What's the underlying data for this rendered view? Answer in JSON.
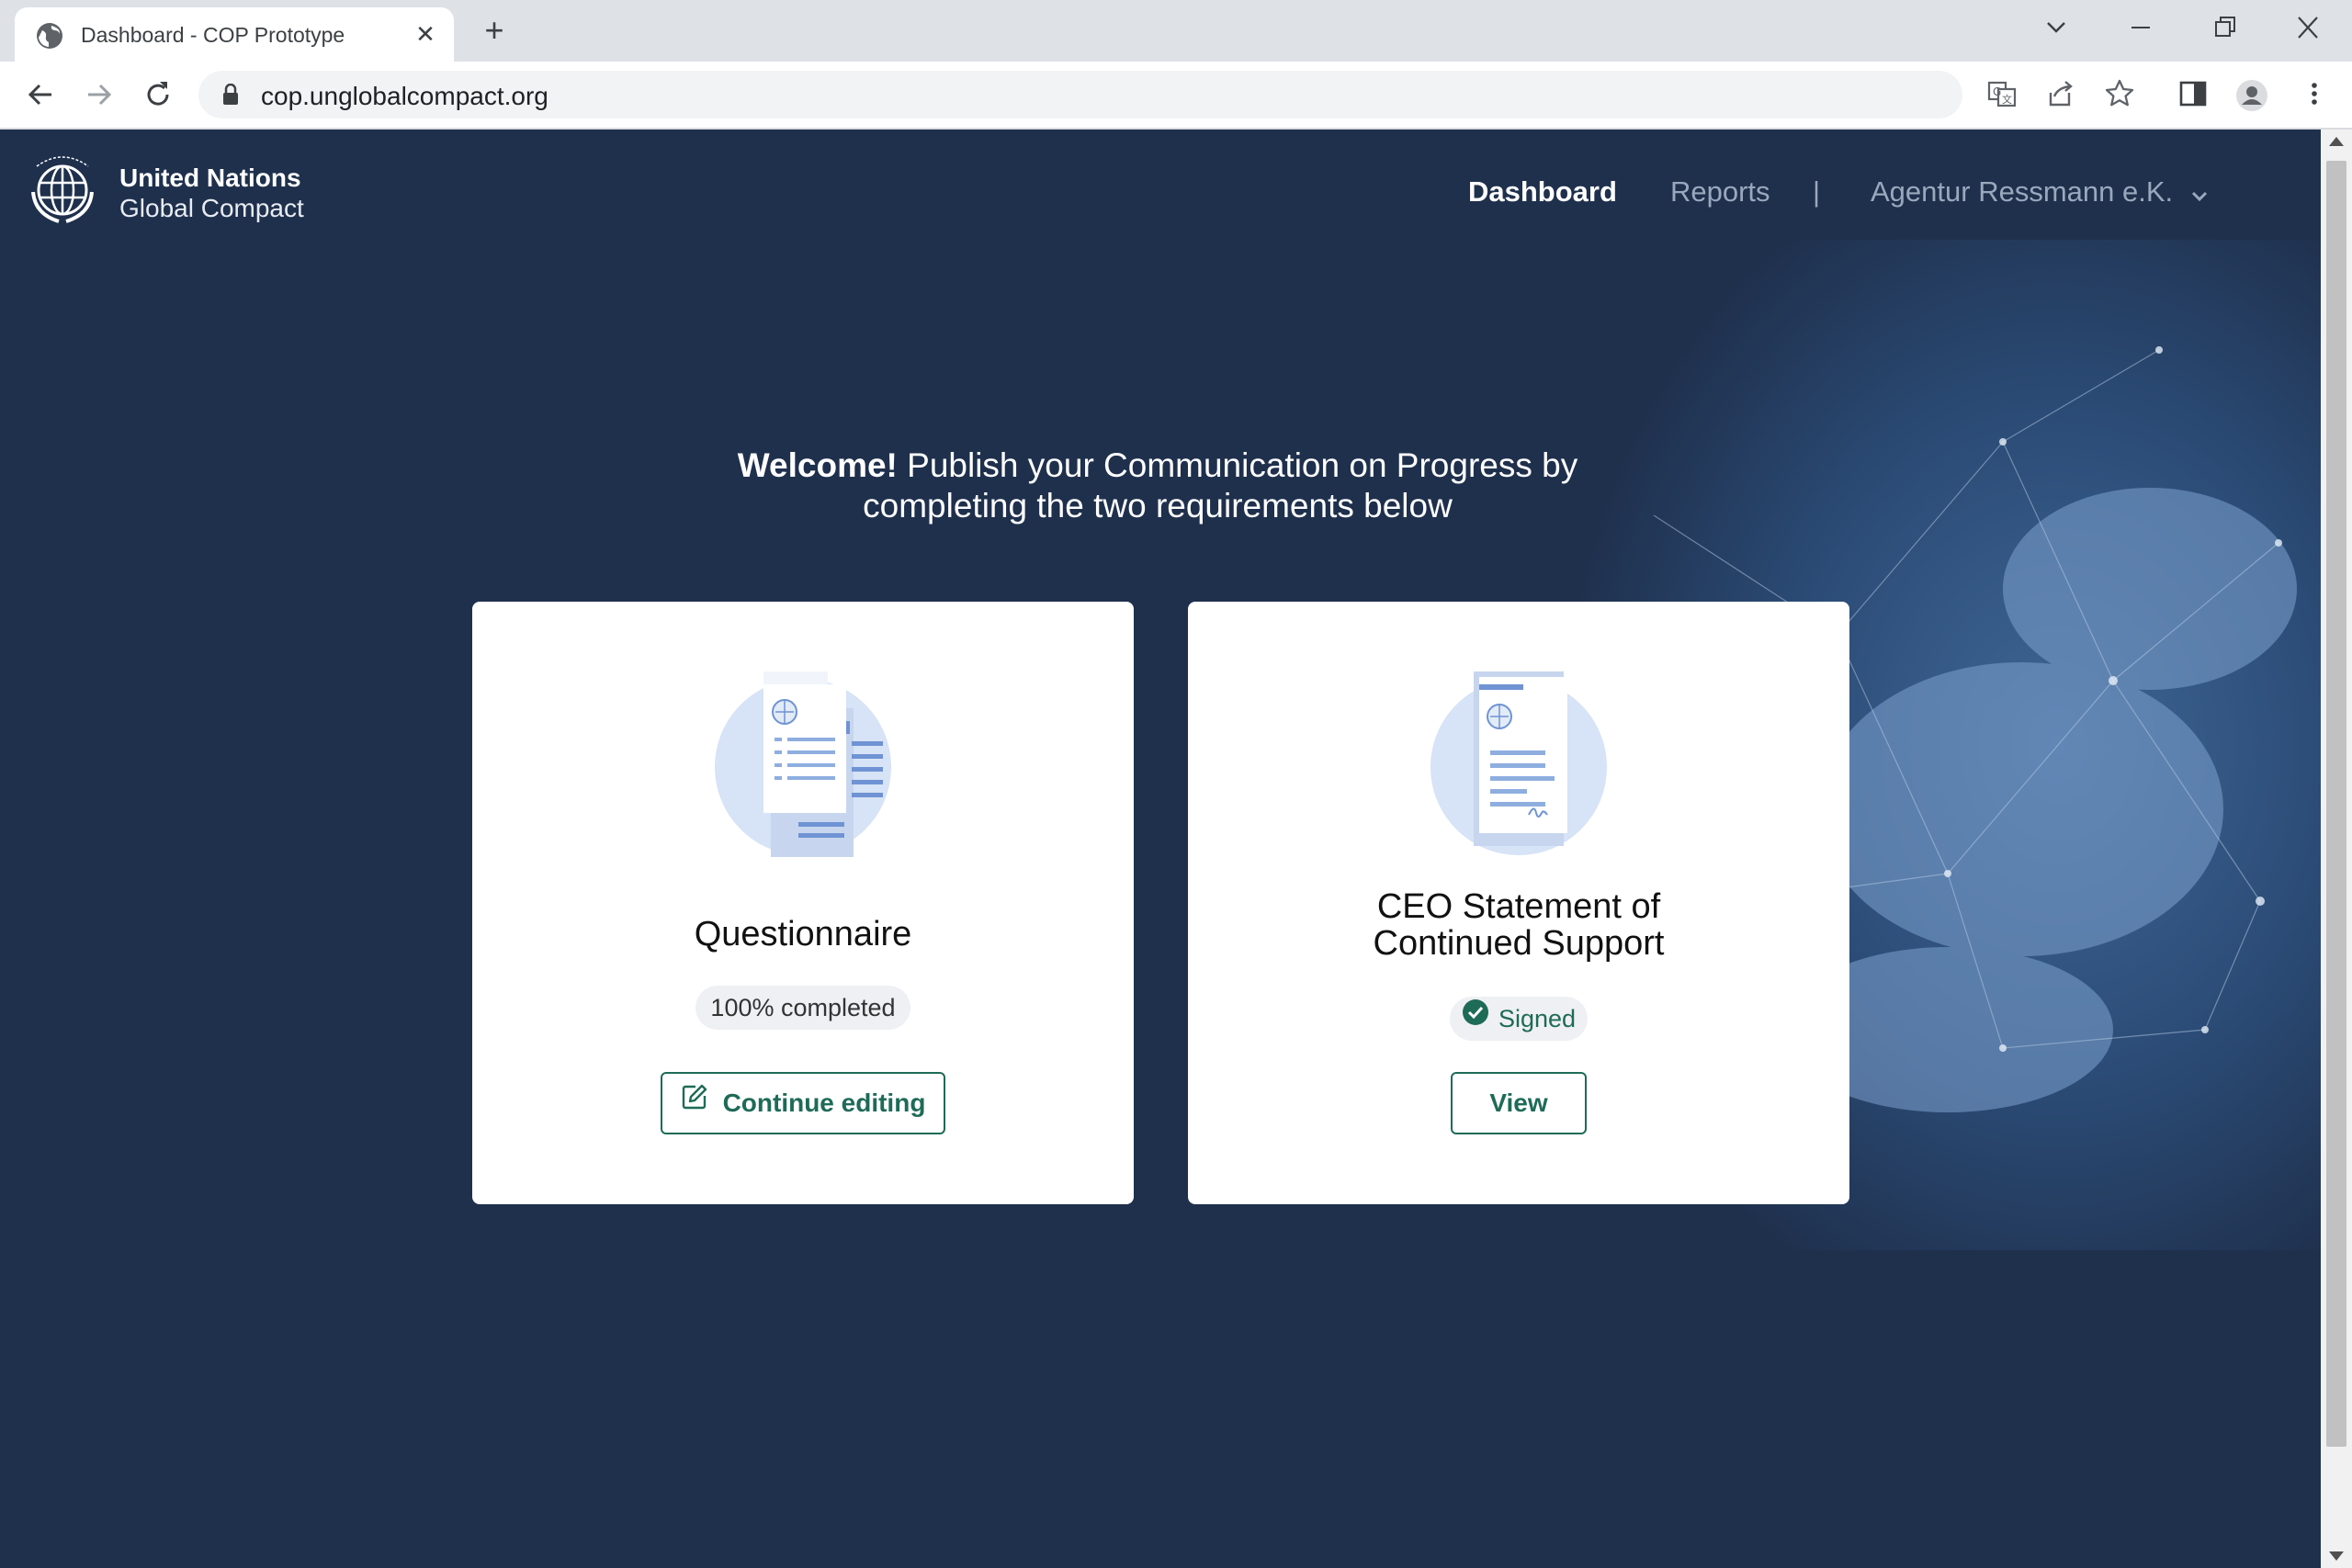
{
  "browser": {
    "tab_title": "Dashboard - COP Prototype",
    "url": "cop.unglobalcompact.org"
  },
  "header": {
    "logo_line1": "United Nations",
    "logo_line2": "Global Compact",
    "nav": {
      "dashboard": "Dashboard",
      "reports": "Reports",
      "separator": "|",
      "account": "Agentur Ressmann e.K."
    }
  },
  "welcome": {
    "bold": "Welcome!",
    "line1": " Publish your Communication on Progress by",
    "line2": "completing the two requirements below"
  },
  "cards": [
    {
      "title": "Questionnaire",
      "status": "100% completed",
      "button": "Continue editing"
    },
    {
      "title_line1": "CEO Statement of",
      "title_line2": "Continued Support",
      "status": "Signed",
      "button": "View"
    }
  ],
  "colors": {
    "page_bg": "#1f304d",
    "accent": "#1e6b57",
    "illustration": "#d7e3f6"
  }
}
